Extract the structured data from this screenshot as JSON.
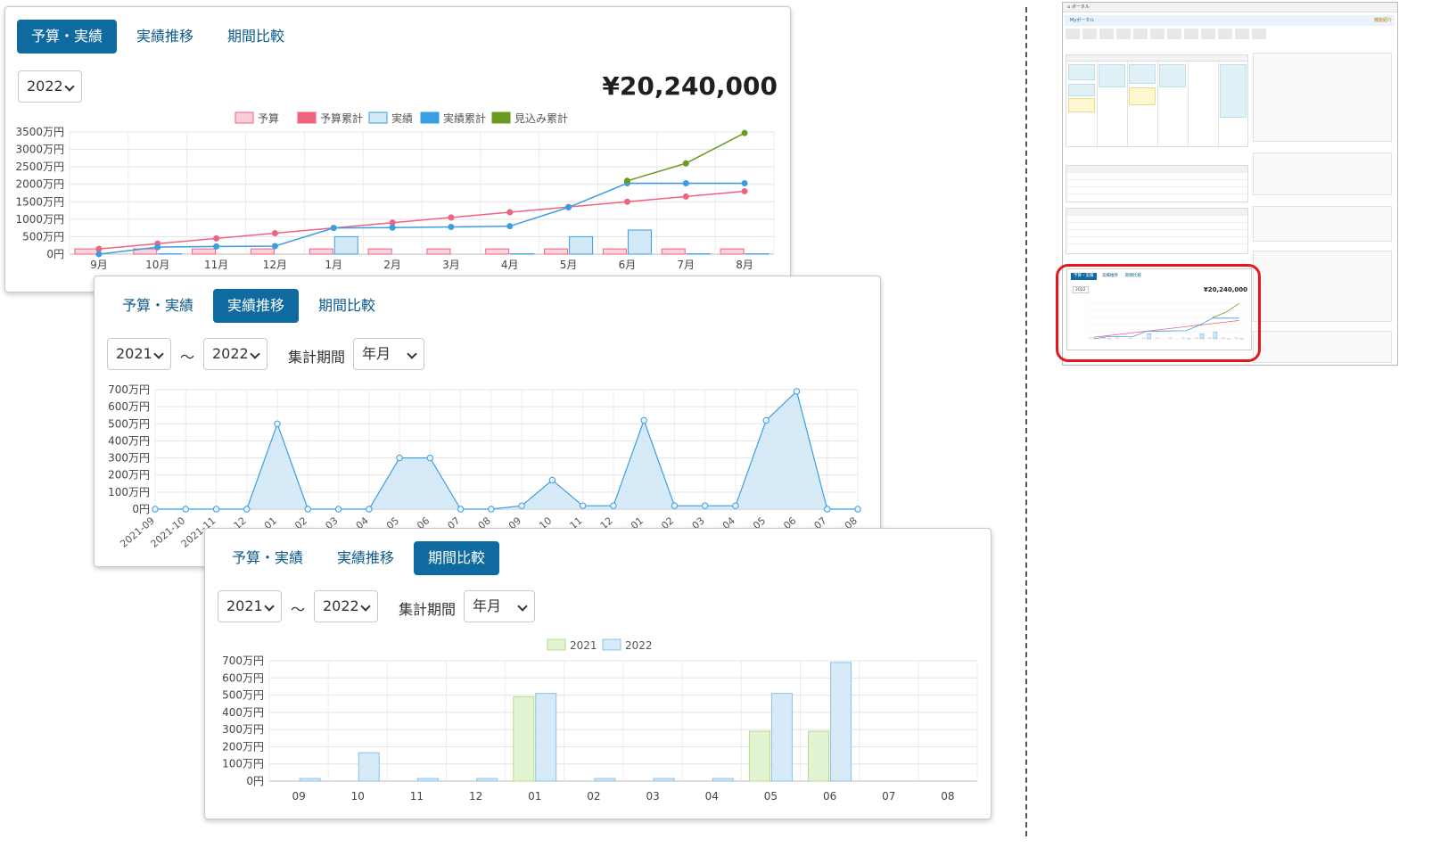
{
  "panel_budget": {
    "tabs": [
      {
        "label": "予算・実績",
        "active": true
      },
      {
        "label": "実績推移",
        "active": false
      },
      {
        "label": "期間比較",
        "active": false
      }
    ],
    "year_select": "2022",
    "total_amount": "¥20,240,000"
  },
  "panel_trend": {
    "tabs": [
      {
        "label": "予算・実績",
        "active": false
      },
      {
        "label": "実績推移",
        "active": true
      },
      {
        "label": "期間比較",
        "active": false
      }
    ],
    "from_year": "2021",
    "range_separator": "～",
    "to_year": "2022",
    "period_label": "集計期間",
    "period_select": "年月"
  },
  "panel_compare": {
    "tabs": [
      {
        "label": "予算・実績",
        "active": false
      },
      {
        "label": "実績推移",
        "active": false
      },
      {
        "label": "期間比較",
        "active": true
      }
    ],
    "from_year": "2021",
    "range_separator": "～",
    "to_year": "2022",
    "period_label": "集計期間",
    "period_select": "年月"
  },
  "thumbnail": {
    "portal_title": "ポータル",
    "portal_heading": "Myポータル",
    "help_link": "機能紹介",
    "widget_tabs": [
      "予算・実績",
      "実績推移",
      "期間比較"
    ],
    "widget_year": "2022",
    "widget_total": "¥20,240,000"
  },
  "colors": {
    "tab_active_bg": "#0f6aa0",
    "tab_text": "#0e5b8c",
    "budget": "#f0637e",
    "actual": "#3a9ee3",
    "forecast": "#6a9a1f",
    "year_2021": "#b5dd8a",
    "year_2022": "#8cc2e8",
    "highlight_ring": "#e6161d"
  },
  "chart_data": [
    {
      "id": "budget_actual",
      "type": "bar+line",
      "categories": [
        "9月",
        "10月",
        "11月",
        "12月",
        "1月",
        "2月",
        "3月",
        "4月",
        "5月",
        "6月",
        "7月",
        "8月"
      ],
      "y_tick_labels": [
        "3500万円",
        "3000万円",
        "2500万円",
        "2000万円",
        "1500万円",
        "1000万円",
        "500万円",
        "0円"
      ],
      "ylim": [
        0,
        3500
      ],
      "unit": "万円",
      "legend_position": "top",
      "series": [
        {
          "name": "予算",
          "type": "bar",
          "color": "#f9cdd6",
          "values": [
            150,
            150,
            150,
            150,
            150,
            150,
            150,
            150,
            150,
            150,
            150,
            150
          ]
        },
        {
          "name": "予算累計",
          "type": "line",
          "color": "#f0637e",
          "values": [
            150,
            300,
            450,
            600,
            750,
            900,
            1050,
            1200,
            1350,
            1500,
            1650,
            1800
          ]
        },
        {
          "name": "実績",
          "type": "bar",
          "color": "#d3e8f7",
          "values": [
            0,
            10,
            0,
            0,
            500,
            0,
            0,
            10,
            500,
            690,
            10,
            10
          ]
        },
        {
          "name": "実績累計",
          "type": "line",
          "color": "#3a9ee3",
          "values": [
            0,
            200,
            220,
            230,
            750,
            760,
            780,
            800,
            1340,
            2030,
            2030,
            2030
          ]
        },
        {
          "name": "見込み累計",
          "type": "line",
          "color": "#6a9a1f",
          "values": [
            null,
            null,
            null,
            null,
            null,
            null,
            null,
            null,
            null,
            2100,
            2600,
            3470
          ]
        }
      ]
    },
    {
      "id": "actual_trend",
      "type": "area",
      "x_labels": [
        "2021-09",
        "2021-10",
        "2021-11",
        "2021-12",
        "2022-01",
        "2022-02",
        "2022-03",
        "2022-04",
        "2022-05",
        "2022-06",
        "2022-07",
        "2022-08",
        "2022-09",
        "2022-10",
        "2022-11",
        "2022-12",
        "2023-01",
        "2023-02",
        "2023-03",
        "2023-04",
        "2023-05",
        "2023-06",
        "2023-07",
        "2023-08"
      ],
      "y_tick_labels": [
        "700万円",
        "600万円",
        "500万円",
        "400万円",
        "300万円",
        "200万円",
        "100万円",
        "0円"
      ],
      "ylim": [
        0,
        700
      ],
      "unit": "万円",
      "series": [
        {
          "name": "実績",
          "color": "#3a9ee3",
          "values": [
            0,
            0,
            0,
            0,
            500,
            0,
            0,
            0,
            300,
            300,
            0,
            0,
            20,
            170,
            20,
            20,
            520,
            20,
            20,
            20,
            520,
            690,
            0,
            0
          ]
        }
      ]
    },
    {
      "id": "period_compare",
      "type": "bar",
      "categories": [
        "09",
        "10",
        "11",
        "12",
        "01",
        "02",
        "03",
        "04",
        "05",
        "06",
        "07",
        "08"
      ],
      "y_tick_labels": [
        "700万円",
        "600万円",
        "500万円",
        "400万円",
        "300万円",
        "200万円",
        "100万円",
        "0円"
      ],
      "ylim": [
        0,
        700
      ],
      "unit": "万円",
      "legend_position": "top",
      "series": [
        {
          "name": "2021",
          "color": "#b5dd8a",
          "fill": "#e3f4d2",
          "values": [
            0,
            0,
            0,
            0,
            490,
            0,
            0,
            0,
            290,
            290,
            0,
            0
          ]
        },
        {
          "name": "2022",
          "color": "#8cc2e8",
          "fill": "#d6eaf8",
          "values": [
            15,
            165,
            15,
            15,
            510,
            15,
            15,
            15,
            510,
            690,
            0,
            0
          ]
        }
      ]
    }
  ]
}
